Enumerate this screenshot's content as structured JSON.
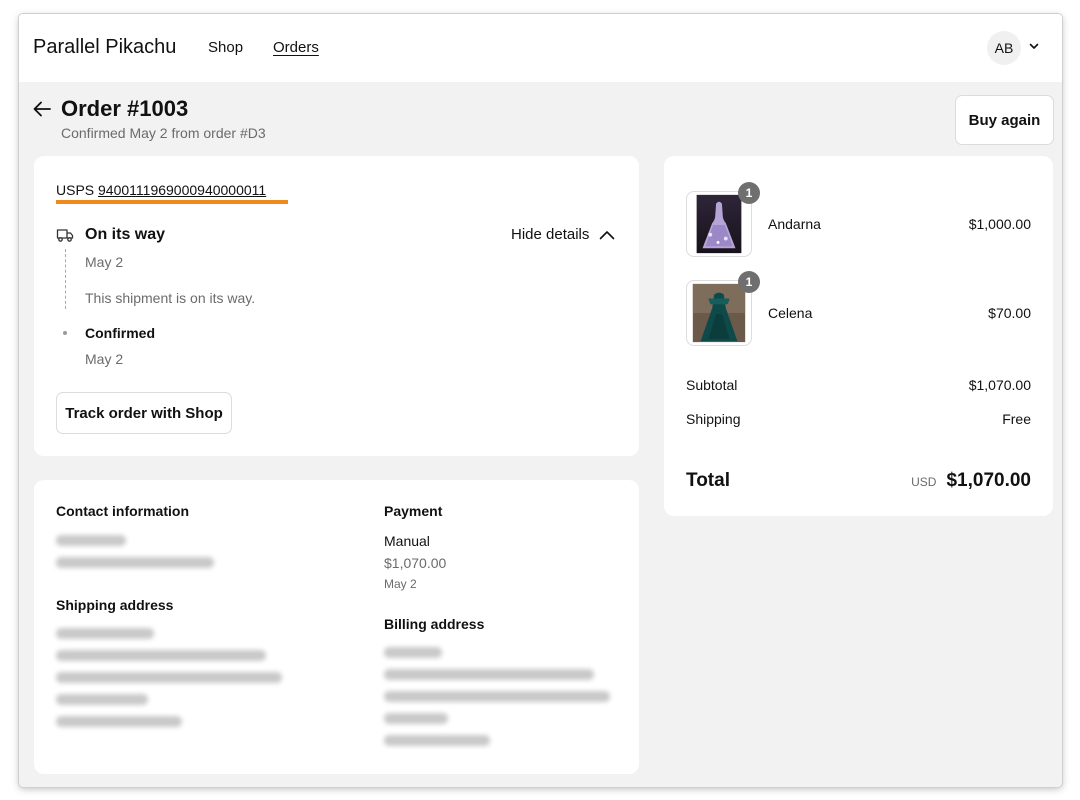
{
  "nav": {
    "brand": "Parallel Pikachu",
    "links": [
      "Shop",
      "Orders"
    ],
    "avatar_initials": "AB"
  },
  "header": {
    "title": "Order #1003",
    "subtitle": "Confirmed May 2 from order #D3",
    "buy_again_label": "Buy again"
  },
  "shipment": {
    "carrier": "USPS",
    "tracking_number": "9400111969000940000011",
    "highlight_color": "#f08a1c",
    "status_title": "On its way",
    "hide_details_label": "Hide details",
    "events": [
      {
        "date": "May 2",
        "description": "This shipment is on its way."
      },
      {
        "title": "Confirmed",
        "date": "May 2"
      }
    ],
    "track_button_label": "Track order with Shop"
  },
  "info": {
    "contact_heading": "Contact information",
    "shipping_heading": "Shipping address",
    "payment_heading": "Payment",
    "payment_method": "Manual",
    "payment_amount": "$1,070.00",
    "payment_date": "May 2",
    "billing_heading": "Billing address"
  },
  "summary": {
    "items": [
      {
        "name": "Andarna",
        "price": "$1,000.00",
        "quantity": "1"
      },
      {
        "name": "Celena",
        "price": "$70.00",
        "quantity": "1"
      }
    ],
    "subtotal_label": "Subtotal",
    "subtotal_value": "$1,070.00",
    "shipping_label": "Shipping",
    "shipping_value": "Free",
    "total_label": "Total",
    "currency": "USD",
    "total_value": "$1,070.00"
  }
}
